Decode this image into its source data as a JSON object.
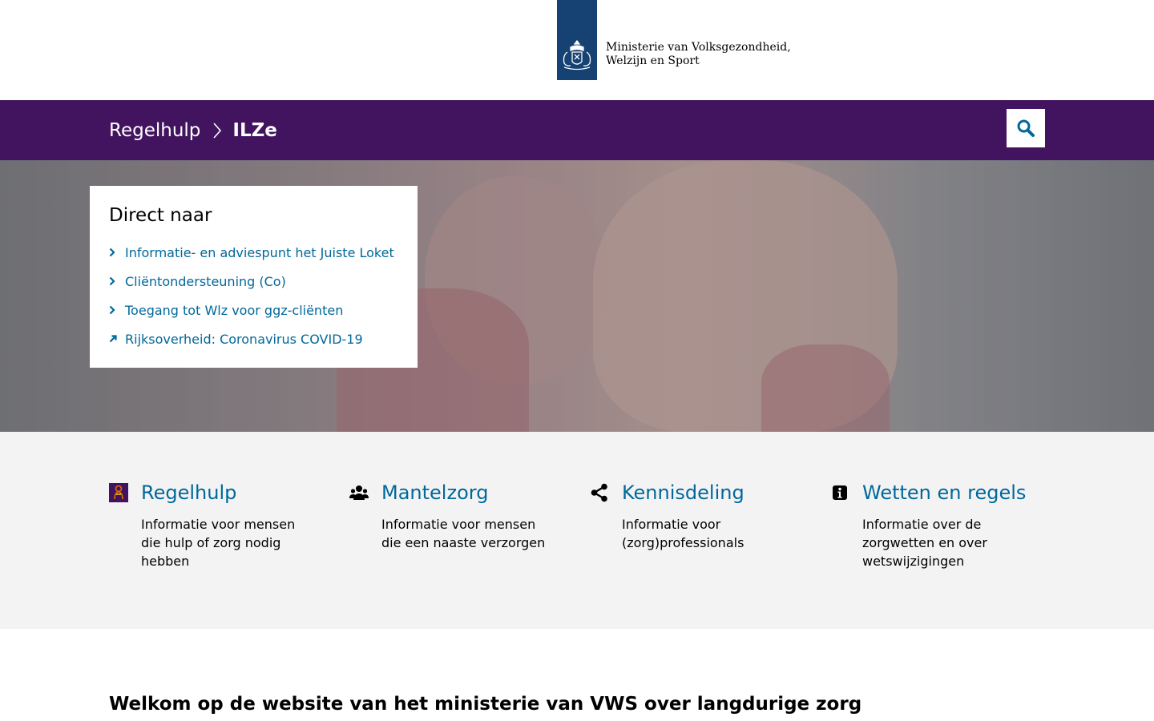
{
  "header": {
    "org_line1": "Ministerie van Volksgezondheid,",
    "org_line2": "Welzijn en Sport",
    "logo_icon": "royal-crest-icon",
    "brand_color": "#154273"
  },
  "navbar": {
    "background": "#42145f",
    "breadcrumb_home": "Regelhulp",
    "breadcrumb_current": "ILZe",
    "search_icon": "search-icon"
  },
  "direct": {
    "title": "Direct naar",
    "link_color": "#01689b",
    "items": [
      {
        "label": "Informatie- en adviespunt het Juiste Loket",
        "icon": "chevron-right-icon"
      },
      {
        "label": "Cliëntondersteuning (Co)",
        "icon": "chevron-right-icon"
      },
      {
        "label": "Toegang tot Wlz voor ggz-cliënten",
        "icon": "chevron-right-icon"
      },
      {
        "label": "Rijksoverheid: Coronavirus COVID-19",
        "icon": "external-link-icon"
      }
    ]
  },
  "categories": [
    {
      "title": "Regelhulp",
      "description": "Informatie voor mensen die hulp of zorg nodig hebben",
      "icon": "regelhulp-icon"
    },
    {
      "title": "Mantelzorg",
      "description": "Informatie voor mensen die een naaste verzorgen",
      "icon": "people-icon"
    },
    {
      "title": "Kennisdeling",
      "description": "Informatie voor (zorg)professionals",
      "icon": "share-icon"
    },
    {
      "title": "Wetten en regels",
      "description": "Informatie over de zorgwetten en over wetswijzigingen",
      "icon": "info-icon"
    }
  ],
  "welcome": {
    "heading": "Welkom op de website van het ministerie van VWS over langdurige zorg"
  }
}
